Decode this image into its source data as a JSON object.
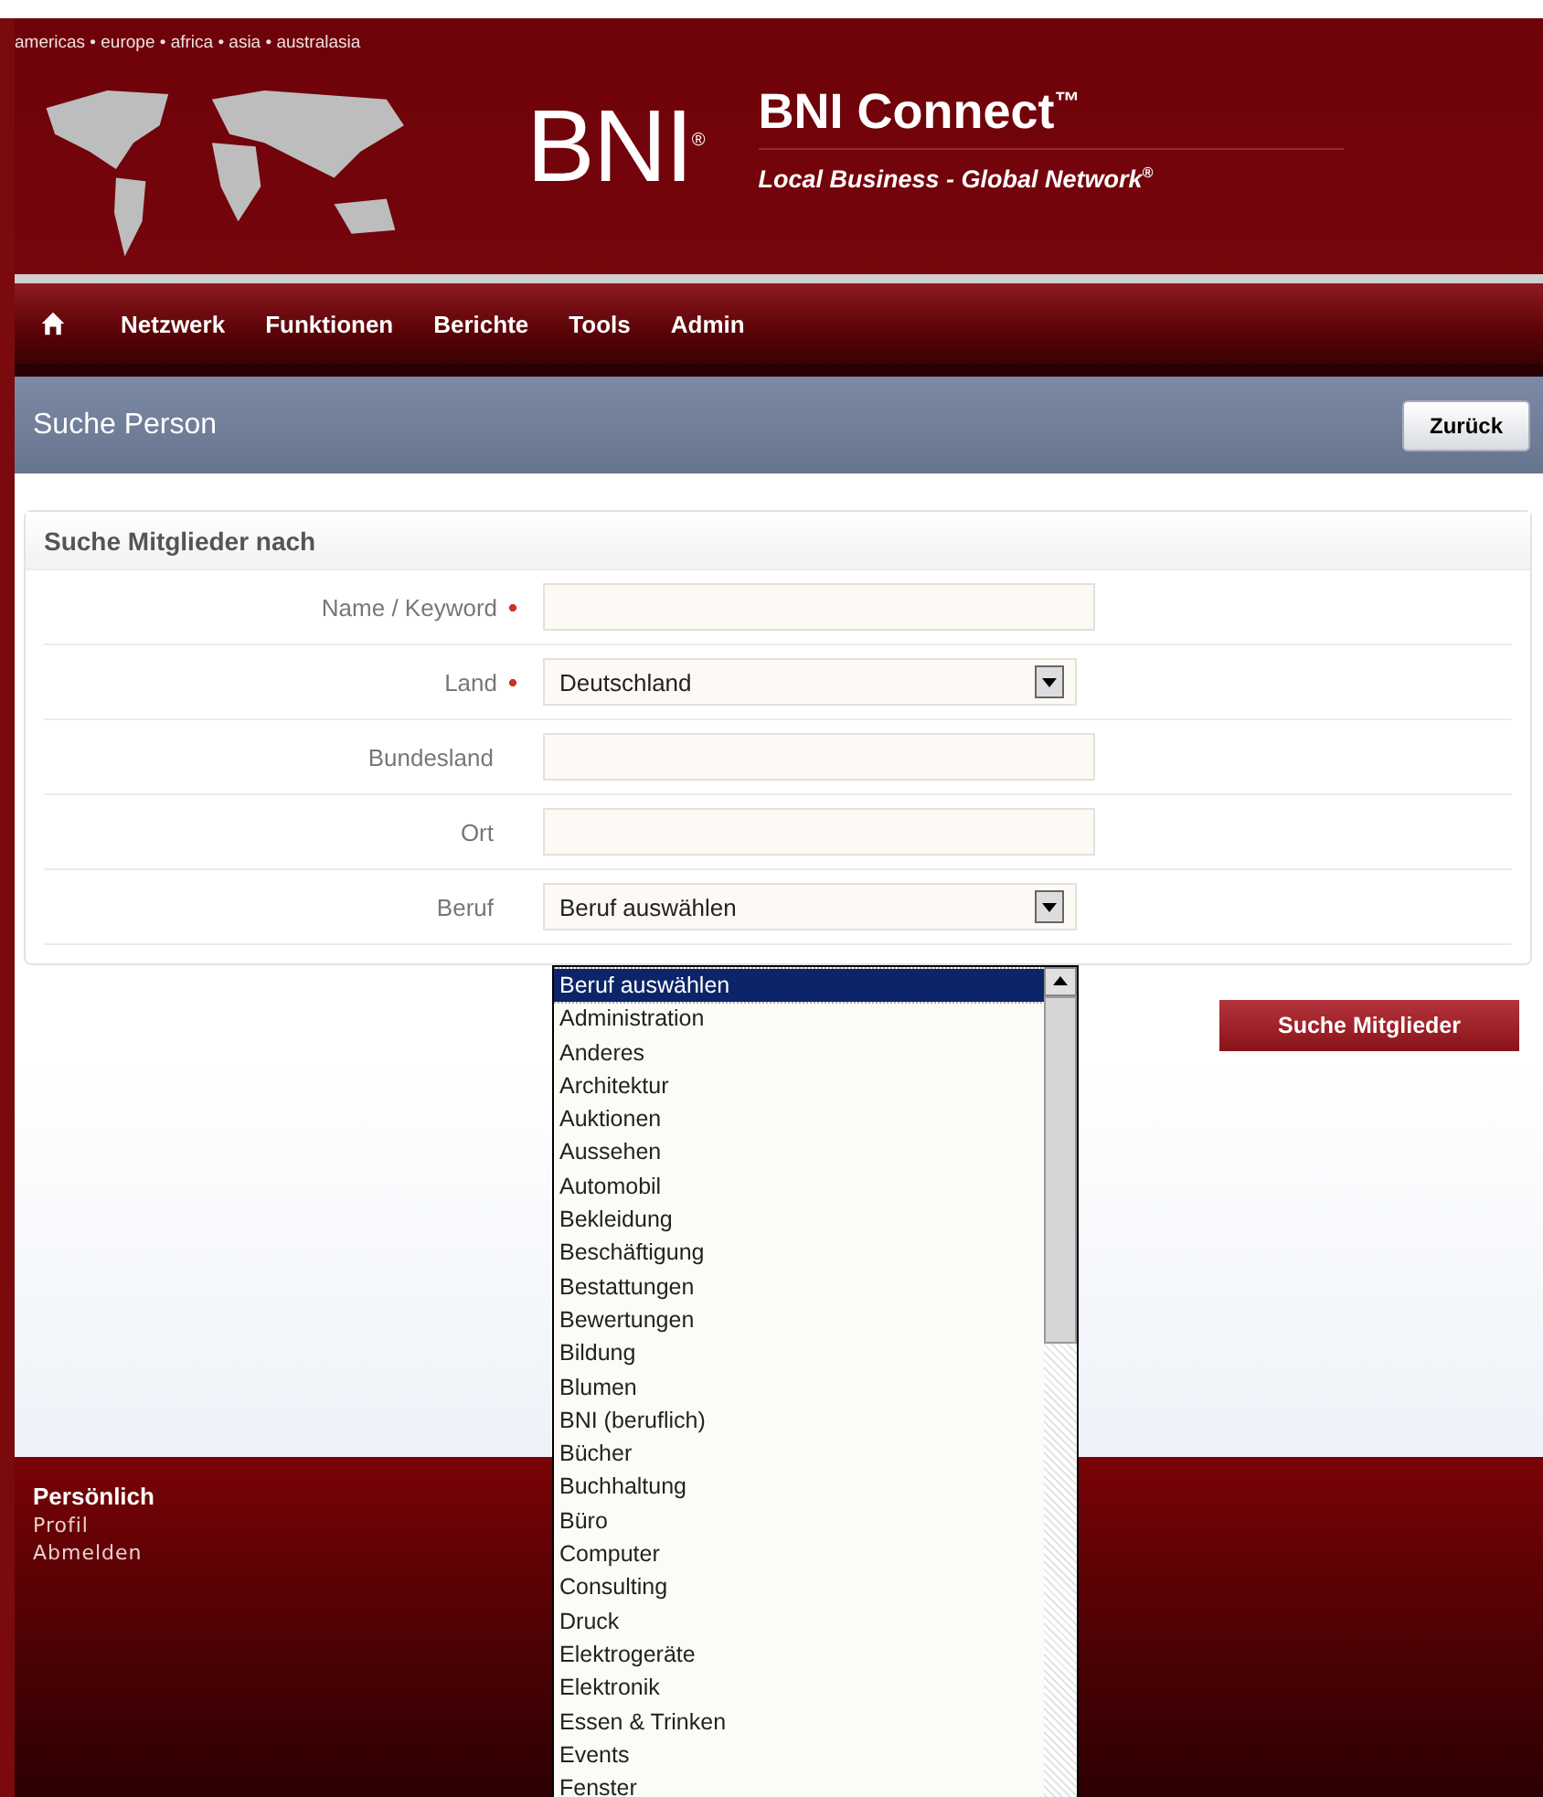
{
  "header": {
    "regions": "americas • europe • africa • asia • australasia",
    "logo": "BNI$^{®}$",
    "title": "BNI Connect$^{™}$",
    "tagline": "Local Business - Global Network$^{®}$"
  },
  "nav": {
    "items": [
      "Netzwerk",
      "Funktionen",
      "Berichte",
      "Tools",
      "Admin"
    ]
  },
  "page_title": "Suche Person",
  "back_button": "Zurück",
  "search_card": {
    "title": "Suche Mitglieder nach",
    "fields": [
      {
        "label": "Name / Keyword",
        "required": true,
        "kind": "text"
      },
      {
        "label": "Land",
        "required": true,
        "kind": "select",
        "value": "Deutschland"
      },
      {
        "label": "Bundesland",
        "required": false,
        "kind": "text"
      },
      {
        "label": "Ort",
        "required": false,
        "kind": "text"
      },
      {
        "label": "Beruf",
        "required": false,
        "kind": "select",
        "value": "Beruf auswählen"
      }
    ]
  },
  "search_button": "Suche Mitglieder",
  "dropdown": {
    "options": [
      {
        "label": "Beruf auswählen",
        "selected": true
      },
      {
        "label": "Administration",
        "selected": false
      },
      {
        "label": "Anderes",
        "selected": false
      },
      {
        "label": "Architektur",
        "selected": false
      },
      {
        "label": "Auktionen",
        "selected": false
      },
      {
        "label": "Aussehen",
        "selected": false
      },
      {
        "label": "Automobil",
        "selected": false
      },
      {
        "label": "Bekleidung",
        "selected": false
      },
      {
        "label": "Beschäftigung",
        "selected": false
      },
      {
        "label": "Bestattungen",
        "selected": false
      },
      {
        "label": "Bewertungen",
        "selected": false
      },
      {
        "label": "Bildung",
        "selected": false
      },
      {
        "label": "Blumen",
        "selected": false
      },
      {
        "label": "BNI (beruflich)",
        "selected": false
      },
      {
        "label": "Bücher",
        "selected": false
      },
      {
        "label": "Buchhaltung",
        "selected": false
      },
      {
        "label": "Büro",
        "selected": false
      },
      {
        "label": "Computer",
        "selected": false
      },
      {
        "label": "Consulting",
        "selected": false
      },
      {
        "label": "Druck",
        "selected": false
      },
      {
        "label": "Elektrogeräte",
        "selected": false
      },
      {
        "label": "Elektronik",
        "selected": false
      },
      {
        "label": "Essen & Trinken",
        "selected": false
      },
      {
        "label": "Events",
        "selected": false
      },
      {
        "label": "Fenster",
        "selected": false
      }
    ]
  },
  "footer": {
    "title": "Persönlich",
    "links": [
      "Profil",
      "Abmelden"
    ]
  }
}
